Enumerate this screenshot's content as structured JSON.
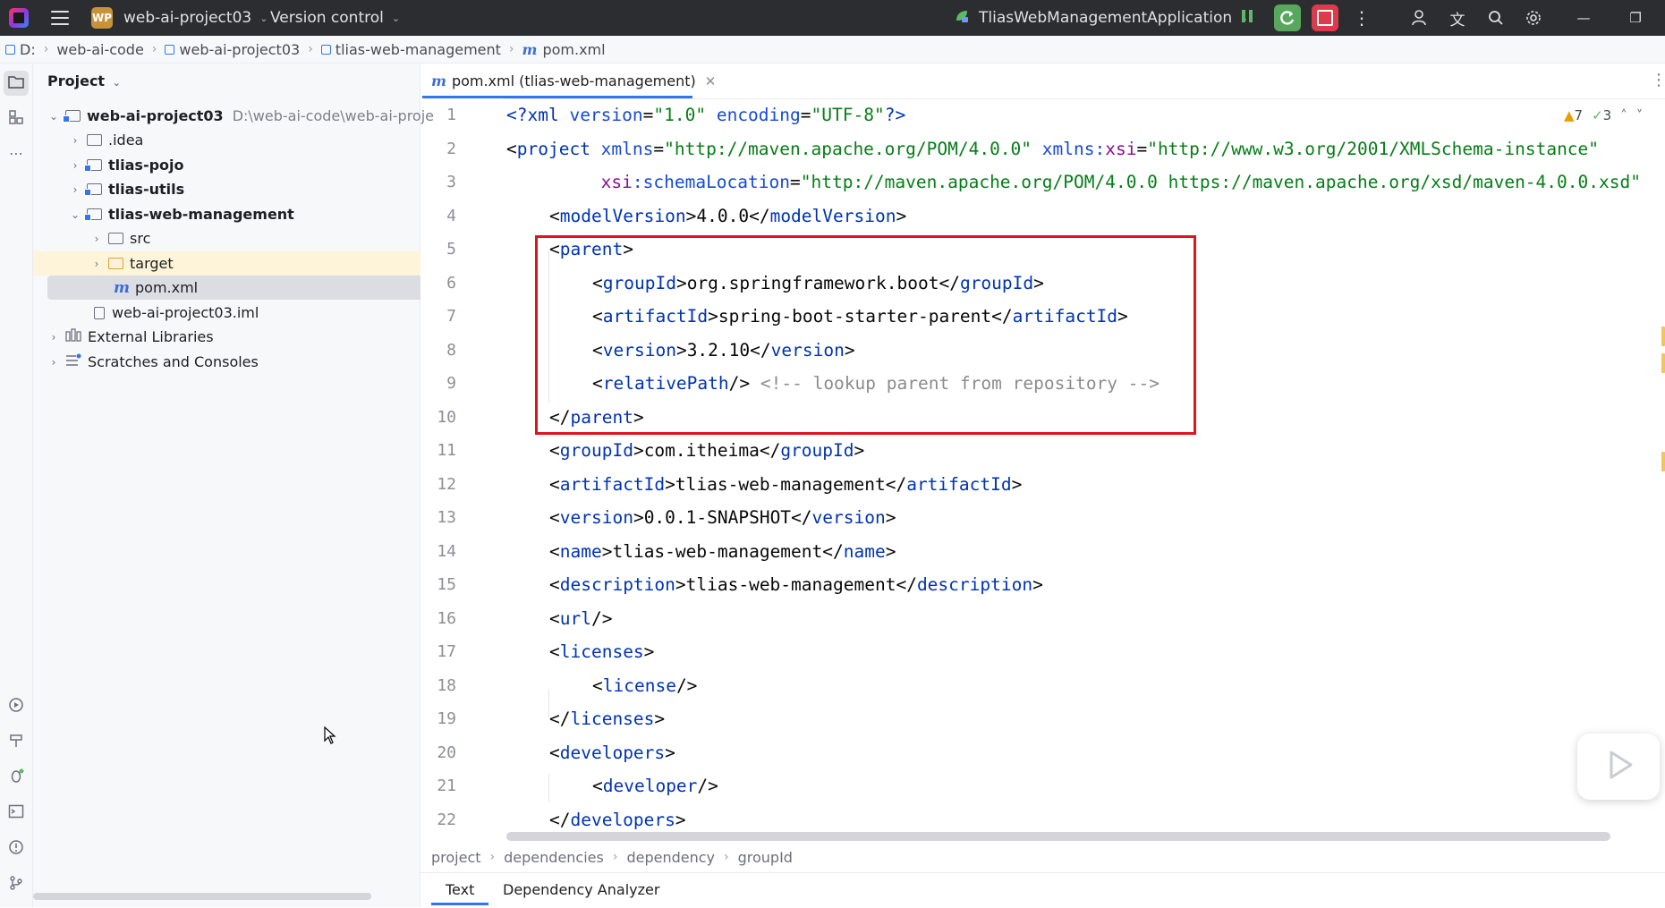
{
  "titlebar": {
    "project_badge": "WP",
    "project_name": "web-ai-project03",
    "version_control": "Version control",
    "run_config": "TliasWebManagementApplication"
  },
  "navbar": {
    "crumbs": [
      "D:",
      "web-ai-code",
      "web-ai-project03",
      "tlias-web-management",
      "pom.xml"
    ]
  },
  "project_panel": {
    "title": "Project",
    "tree": [
      {
        "label": "web-ai-project03",
        "path": "D:\\web-ai-code\\web-ai-proje"
      },
      {
        "label": ".idea"
      },
      {
        "label": "tlias-pojo"
      },
      {
        "label": "tlias-utils"
      },
      {
        "label": "tlias-web-management"
      },
      {
        "label": "src"
      },
      {
        "label": "target"
      },
      {
        "label": "pom.xml"
      },
      {
        "label": "web-ai-project03.iml"
      },
      {
        "label": "External Libraries"
      },
      {
        "label": "Scratches and Consoles"
      }
    ]
  },
  "editor": {
    "tab_label": "pom.xml (tlias-web-management)",
    "tab_icon_letter": "m",
    "warnings": "7",
    "checks": "3",
    "line_numbers": [
      "1",
      "2",
      "3",
      "4",
      "5",
      "6",
      "7",
      "8",
      "9",
      "10",
      "11",
      "12",
      "13",
      "14",
      "15",
      "16",
      "17",
      "18",
      "19",
      "20",
      "21",
      "22"
    ],
    "code": {
      "l1": {
        "a": "<?",
        "b": "xml ",
        "c": "version",
        "d": "=",
        "e": "\"1.0\"",
        "f": " encoding",
        "g": "=",
        "h": "\"UTF-8\"",
        "i": "?>"
      },
      "l2": {
        "a": "<",
        "b": "project ",
        "c": "xmlns",
        "d": "=",
        "e": "\"http://maven.apache.org/POM/4.0.0\"",
        "f": " xmlns:",
        "g": "xsi",
        "h": "=",
        "i": "\"http://www.w3.org/2001/XMLSchema-instance\""
      },
      "l3": {
        "a": "         xsi",
        "b": ":schemaLocation",
        "c": "=",
        "d": "\"http://maven.apache.org/POM/4.0.0 https://maven.apache.org/xsd/maven-4.0.0.xsd\""
      },
      "l4": {
        "tag": "modelVersion",
        "val": "4.0.0"
      },
      "l5": {
        "tag": "parent"
      },
      "l6": {
        "tag": "groupId",
        "val": "org.springframework.boot"
      },
      "l7": {
        "tag": "artifactId",
        "val": "spring-boot-starter-parent"
      },
      "l8": {
        "tag": "version",
        "val": "3.2.10"
      },
      "l9": {
        "tag": "relativePath",
        "comment": "<!-- lookup parent from repository -->"
      },
      "l10": {
        "tag": "parent"
      },
      "l11": {
        "tag": "groupId",
        "val": "com.itheima"
      },
      "l12": {
        "tag": "artifactId",
        "val": "tlias-web-management"
      },
      "l13": {
        "tag": "version",
        "val": "0.0.1-SNAPSHOT"
      },
      "l14": {
        "tag": "name",
        "val": "tlias-web-management"
      },
      "l15": {
        "tag": "description",
        "val": "tlias-web-management"
      },
      "l16": {
        "tag": "url"
      },
      "l17": {
        "tag": "licenses"
      },
      "l18": {
        "tag": "license"
      },
      "l19": {
        "tag": "licenses"
      },
      "l20": {
        "tag": "developers"
      },
      "l21": {
        "tag": "developer"
      },
      "l22": {
        "tag": "developers"
      }
    }
  },
  "xml_breadcrumb": [
    "project",
    "dependencies",
    "dependency",
    "groupId"
  ],
  "bottom_tabs": [
    "Text",
    "Dependency Analyzer"
  ],
  "colors": {
    "accent": "#3574f0",
    "highlight_box": "#e0141e",
    "tag": "#0033b3",
    "string": "#067d17",
    "comment": "#8c8c8c"
  }
}
